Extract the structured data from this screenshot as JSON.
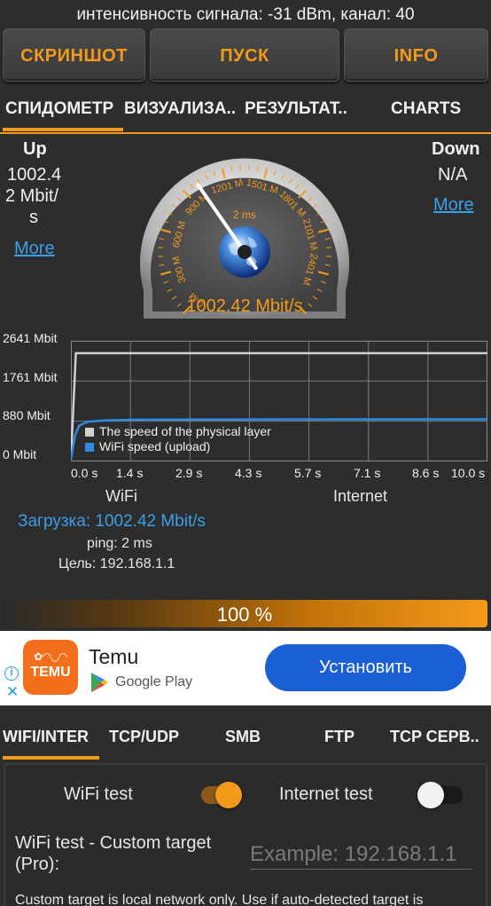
{
  "status": {
    "line": "интенсивность сигнала: -31 dBm, канал: 40"
  },
  "toolbar": {
    "screenshot": "СКРИНШОТ",
    "start": "ПУСК",
    "info": "INFO"
  },
  "tabs": [
    "СПИДОМЕТР",
    "ВИЗУАЛИЗА..",
    "РЕЗУЛЬТАТ..",
    "CHARTS"
  ],
  "upload": {
    "title": "Up",
    "value_line1": "1002.4",
    "value_line2": "2 Mbit/",
    "value_line3": "s",
    "more": "More"
  },
  "download": {
    "title": "Down",
    "value": "N/A",
    "more": "More"
  },
  "gauge": {
    "ticks": [
      "0 M",
      "300 M",
      "600 M",
      "900 M",
      "1201 M",
      "1501 M",
      "1801 M",
      "2101 M",
      "2401 M"
    ],
    "ping": "2 ms",
    "readout": "1002.42 Mbit/s",
    "max_value": 2701,
    "needle_value": 1002.42
  },
  "chart_data": {
    "type": "line",
    "y_ticks": [
      "2641 Mbit",
      "1761 Mbit",
      "880 Mbit",
      "0 Mbit"
    ],
    "x_ticks": [
      "0.0 s",
      "1.4 s",
      "2.9 s",
      "4.3 s",
      "5.7 s",
      "7.1 s",
      "8.6 s",
      "10.0 s"
    ],
    "ylim": [
      0,
      2641
    ],
    "xlim": [
      0,
      10
    ],
    "series": [
      {
        "name": "The speed of the physical layer",
        "color": "#d0d0d0",
        "x": [
          0,
          0.12,
          10
        ],
        "y": [
          0,
          2641,
          2641
        ]
      },
      {
        "name": "WiFi speed (upload)",
        "color": "#2f8ae3",
        "x": [
          0,
          0.1,
          0.2,
          0.4,
          0.8,
          1.5,
          3,
          5,
          7,
          10
        ],
        "y": [
          0,
          600,
          850,
          940,
          975,
          990,
          995,
          1000,
          1002,
          1002
        ]
      }
    ],
    "grid": true,
    "legend": "bottom-left"
  },
  "labels": {
    "wifi": "WiFi",
    "internet": "Internet"
  },
  "results": {
    "upload": "Загрузка: 1002.42 Mbit/s",
    "ping": "ping: 2 ms",
    "target": "Цель: 192.168.1.1"
  },
  "progress": {
    "label": "100 %",
    "value": 1.0
  },
  "ad": {
    "logo_text": "TEMU",
    "title": "Temu",
    "store": "Google Play",
    "cta": "Установить"
  },
  "bottom_tabs": [
    "WIFI/INTER",
    "TCP/UDP",
    "SMB",
    "FTP",
    "TCP СЕРВ.."
  ],
  "settings": {
    "wifi_test": "WiFi test",
    "internet_test": "Internet test",
    "custom_target_label": "WiFi test - Custom target (Pro):",
    "custom_target_placeholder": "Example: 192.168.1.1",
    "footnote": "Custom target is local network only. Use if auto-detected target is"
  },
  "colors": {
    "accent": "#f39a1b",
    "link": "#3aa0e8",
    "background": "#2d2d2d"
  }
}
